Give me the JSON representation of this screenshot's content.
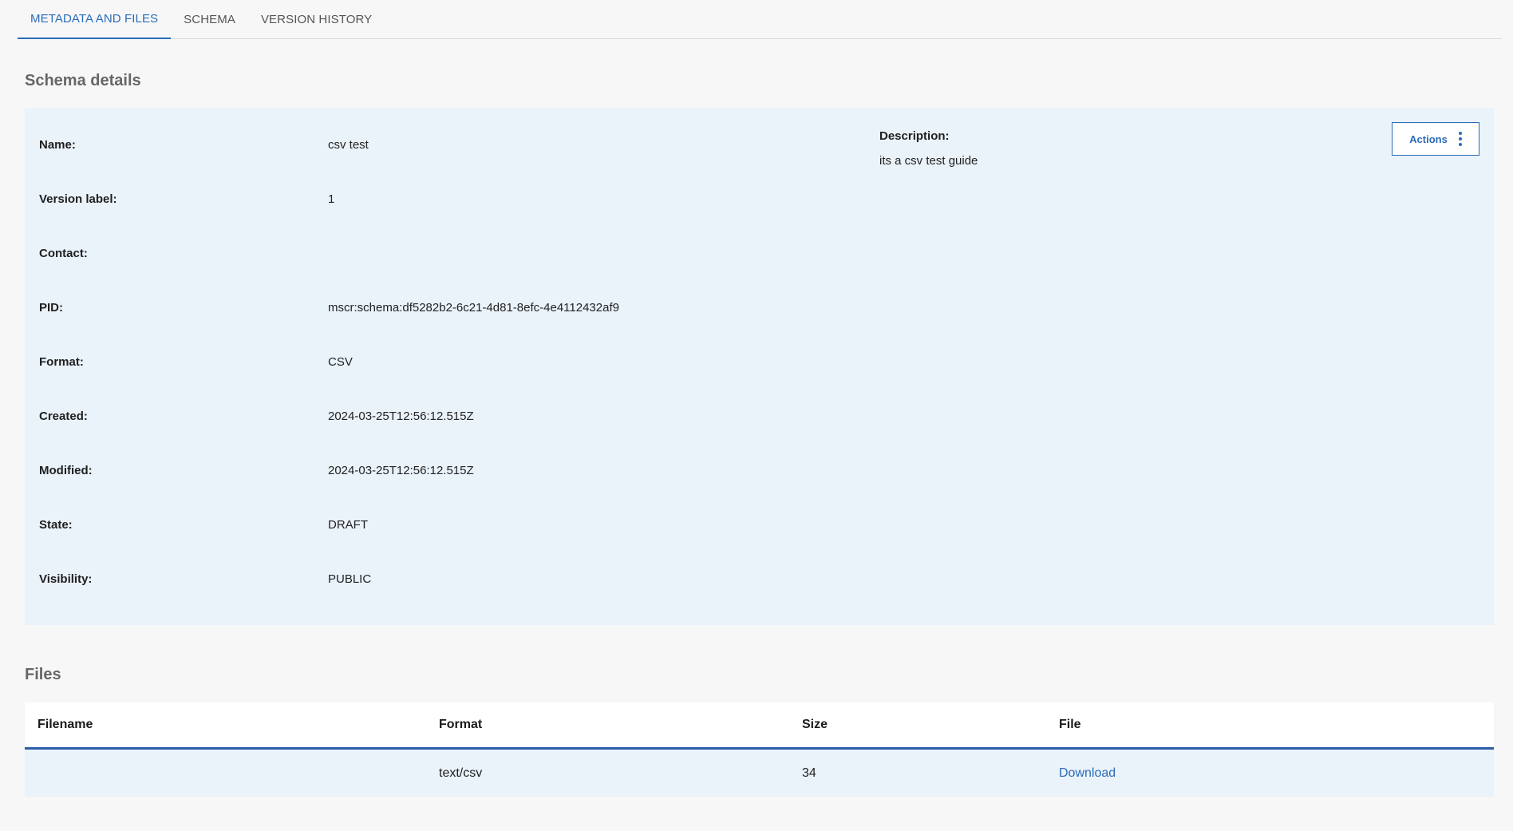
{
  "tabs": [
    {
      "label": "METADATA AND FILES",
      "active": true
    },
    {
      "label": "SCHEMA",
      "active": false
    },
    {
      "label": "VERSION HISTORY",
      "active": false
    }
  ],
  "schema_details": {
    "heading": "Schema details",
    "fields": [
      {
        "label": "Name:",
        "value": "csv test"
      },
      {
        "label": "Version label:",
        "value": "1"
      },
      {
        "label": "Contact:",
        "value": ""
      },
      {
        "label": "PID:",
        "value": "mscr:schema:df5282b2-6c21-4d81-8efc-4e4112432af9"
      },
      {
        "label": "Format:",
        "value": "CSV"
      },
      {
        "label": "Created:",
        "value": "2024-03-25T12:56:12.515Z"
      },
      {
        "label": "Modified:",
        "value": "2024-03-25T12:56:12.515Z"
      },
      {
        "label": "State:",
        "value": "DRAFT"
      },
      {
        "label": "Visibility:",
        "value": "PUBLIC"
      }
    ],
    "description_label": "Description:",
    "description_value": "its a csv test guide",
    "actions_label": "Actions",
    "actions_icon": "kebab-menu-icon"
  },
  "files": {
    "heading": "Files",
    "columns": [
      "Filename",
      "Format",
      "Size",
      "File"
    ],
    "rows": [
      {
        "filename": "",
        "format": "text/csv",
        "size": "34",
        "file": "Download"
      }
    ]
  },
  "colors": {
    "accent": "#2a6cb8",
    "panel_bg": "#eaf2fa",
    "page_bg": "#f7f7f7"
  }
}
